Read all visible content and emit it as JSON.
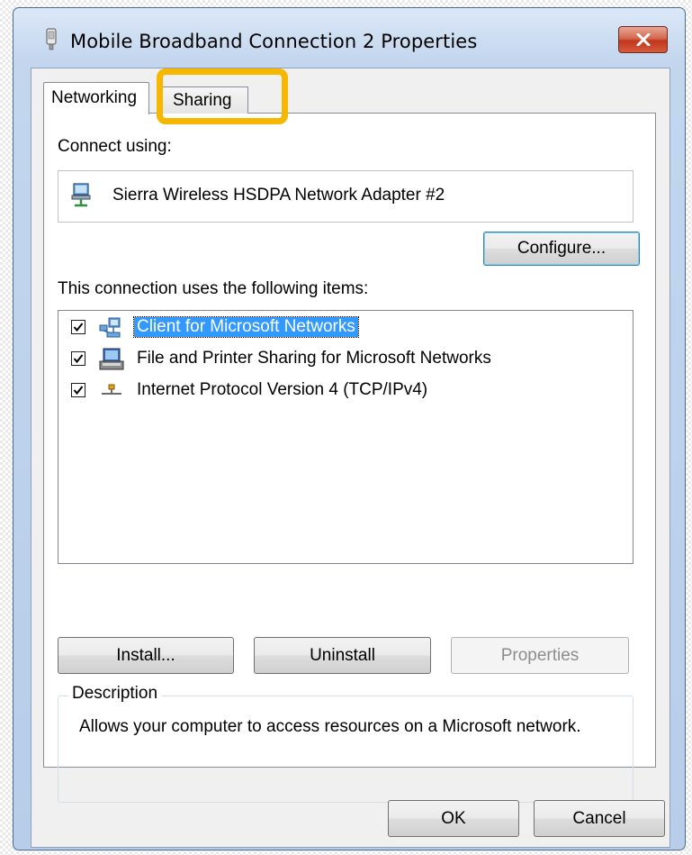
{
  "window": {
    "title": "Mobile Broadband Connection 2 Properties",
    "close_icon": "close-icon"
  },
  "tabs": [
    {
      "label": "Networking",
      "selected": true
    },
    {
      "label": "Sharing",
      "selected": false,
      "highlighted": true
    }
  ],
  "networking": {
    "connect_using_label": "Connect using:",
    "adapter_name": "Sierra Wireless HSDPA Network Adapter #2",
    "adapter_icon": "network-adapter-icon",
    "configure_button": "Configure...",
    "items_label": "This connection uses the following items:",
    "items": [
      {
        "label": "Client for Microsoft Networks",
        "checked": true,
        "selected": true,
        "icon": "network-client-icon"
      },
      {
        "label": "File and Printer Sharing for Microsoft Networks",
        "checked": true,
        "selected": false,
        "icon": "file-printer-sharing-icon"
      },
      {
        "label": "Internet Protocol Version 4 (TCP/IPv4)",
        "checked": true,
        "selected": false,
        "icon": "protocol-icon"
      }
    ],
    "install_button": "Install...",
    "uninstall_button": "Uninstall",
    "properties_button": "Properties",
    "properties_enabled": false,
    "description_legend": "Description",
    "description_text": "Allows your computer to access resources on a Microsoft network."
  },
  "footer": {
    "ok_button": "OK",
    "cancel_button": "Cancel"
  },
  "colors": {
    "highlight": "#f6b700",
    "selection": "#3399ff",
    "close_button": "#c1371e"
  }
}
